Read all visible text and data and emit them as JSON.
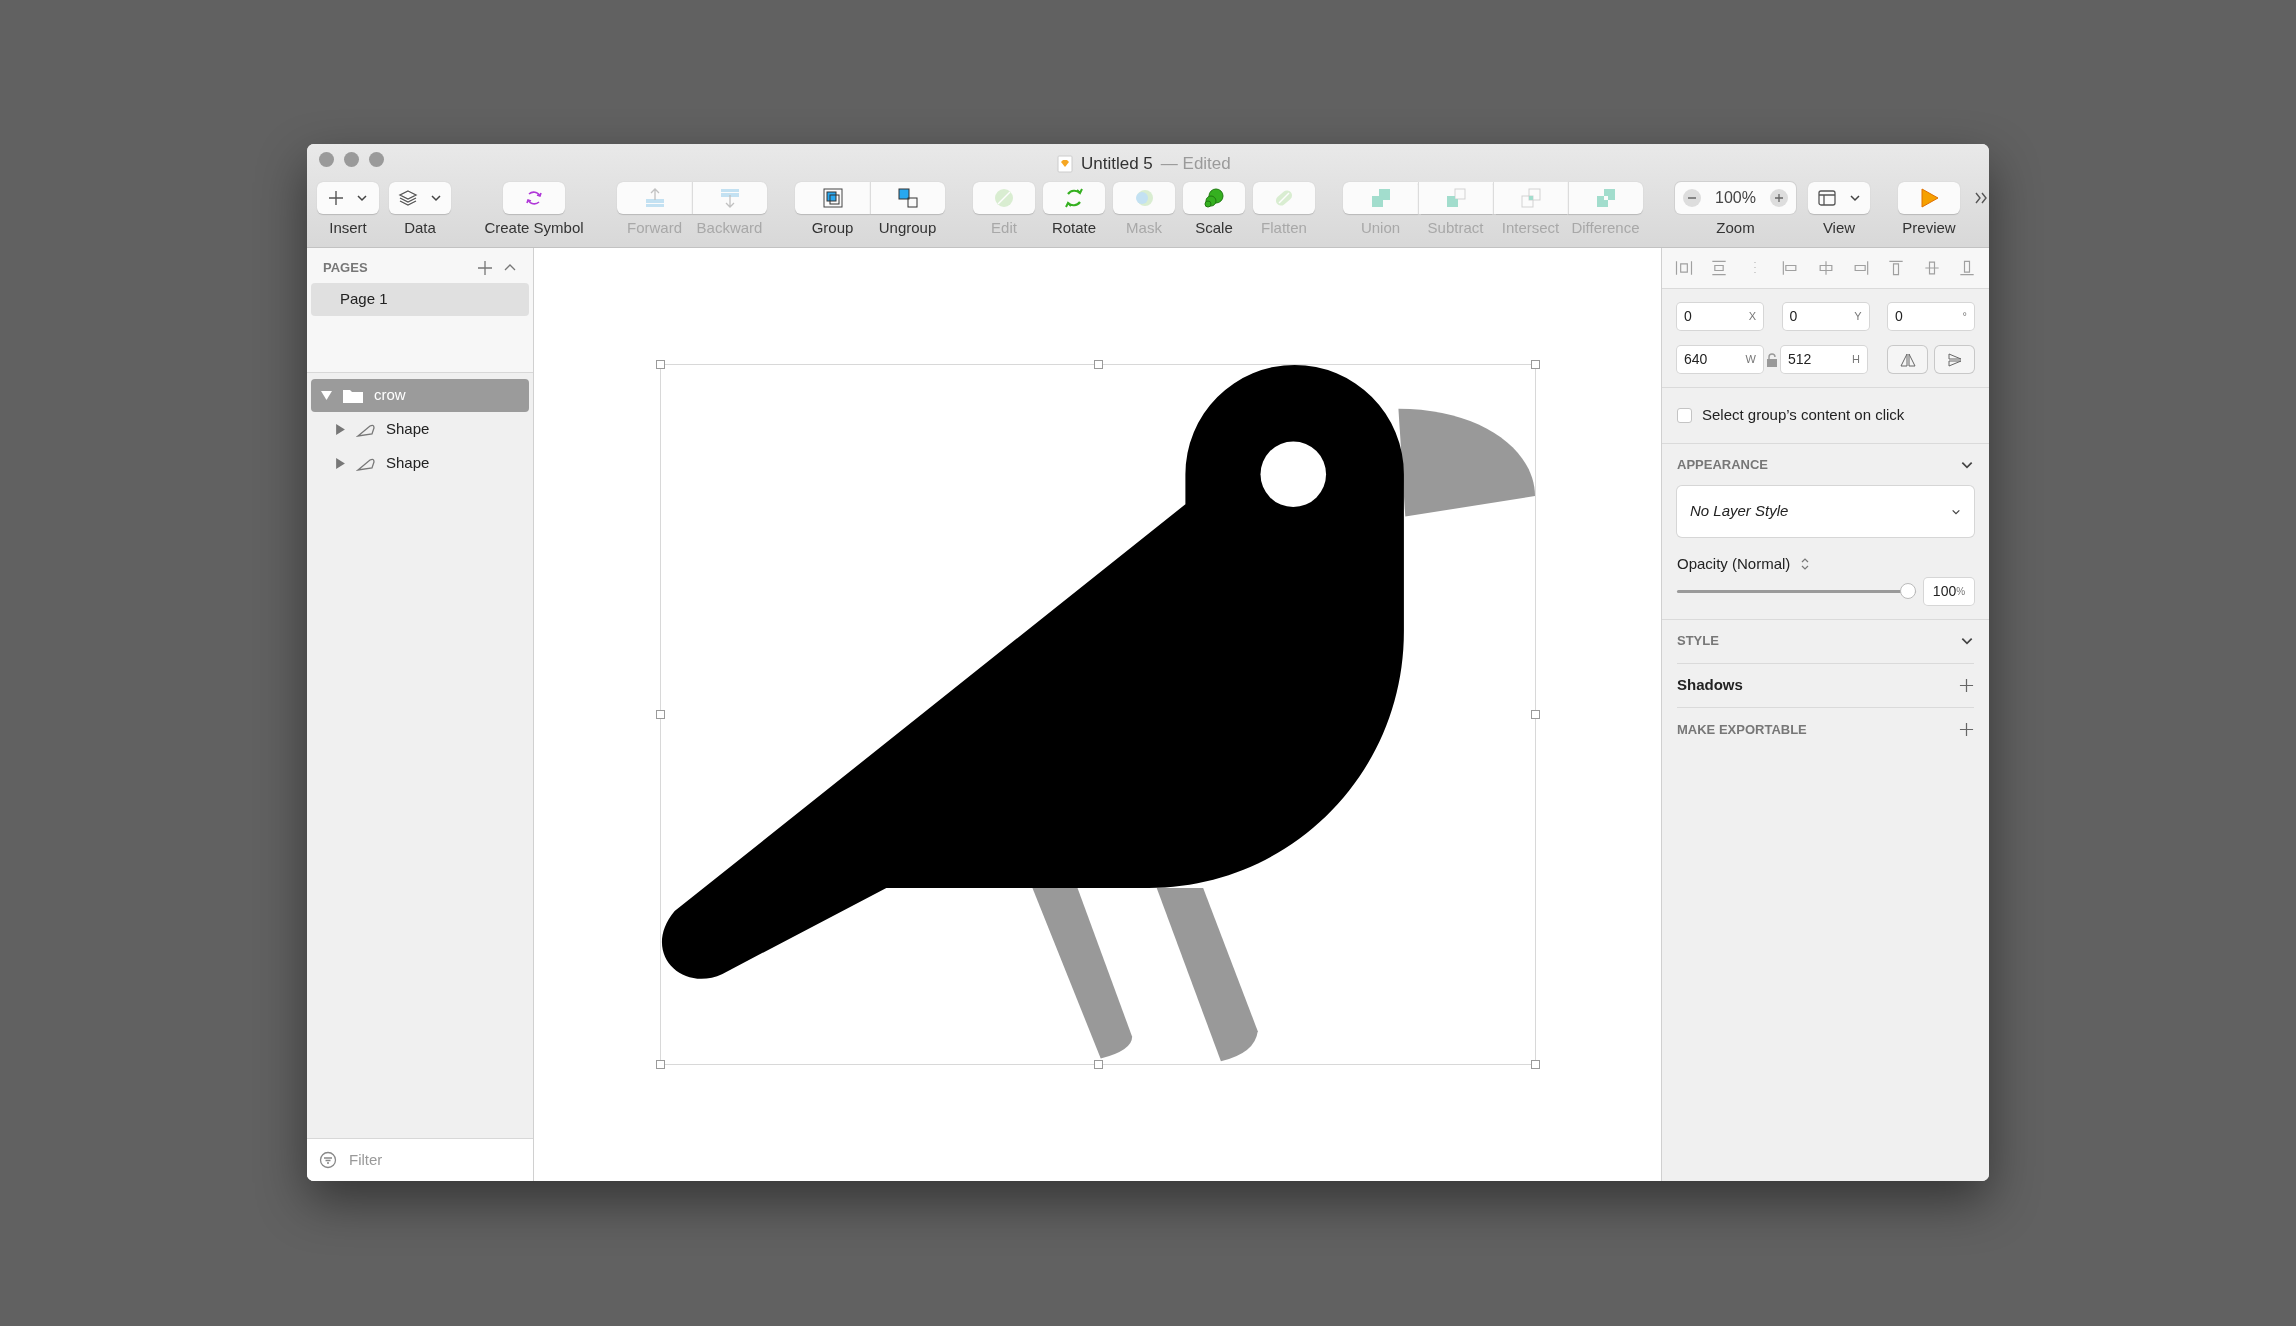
{
  "window": {
    "title": "Untitled 5",
    "status": "— Edited"
  },
  "toolbar": [
    {
      "items": [
        {
          "kind": "insert",
          "label": "Insert",
          "disabled": false
        },
        {
          "kind": "data",
          "label": "Data",
          "disabled": false
        }
      ]
    },
    {
      "items": [
        {
          "kind": "symbol",
          "label": "Create Symbol",
          "disabled": false
        }
      ]
    },
    {
      "segmented": true,
      "items": [
        {
          "kind": "forward",
          "label": "Forward",
          "disabled": true
        },
        {
          "kind": "backward",
          "label": "Backward",
          "disabled": true
        }
      ]
    },
    {
      "segmented": true,
      "items": [
        {
          "kind": "group",
          "label": "Group",
          "disabled": false
        },
        {
          "kind": "ungroup",
          "label": "Ungroup",
          "disabled": false
        }
      ]
    },
    {
      "items": [
        {
          "kind": "edit",
          "label": "Edit",
          "disabled": true
        },
        {
          "kind": "rotate",
          "label": "Rotate",
          "disabled": false
        },
        {
          "kind": "mask",
          "label": "Mask",
          "disabled": true
        },
        {
          "kind": "scale",
          "label": "Scale",
          "disabled": false
        },
        {
          "kind": "flatten",
          "label": "Flatten",
          "disabled": true
        }
      ]
    },
    {
      "segmented": true,
      "items": [
        {
          "kind": "union",
          "label": "Union",
          "disabled": true
        },
        {
          "kind": "subtract",
          "label": "Subtract",
          "disabled": true
        },
        {
          "kind": "intersect",
          "label": "Intersect",
          "disabled": true
        },
        {
          "kind": "difference",
          "label": "Difference",
          "disabled": true
        }
      ]
    },
    {
      "items": [
        {
          "kind": "zoom",
          "label": "Zoom",
          "value": "100%",
          "disabled": false
        }
      ]
    },
    {
      "items": [
        {
          "kind": "view",
          "label": "View",
          "disabled": false
        }
      ]
    },
    {
      "items": [
        {
          "kind": "preview",
          "label": "Preview",
          "disabled": false
        }
      ]
    }
  ],
  "sidebar": {
    "pages_title": "PAGES",
    "pages": [
      {
        "label": "Page 1",
        "selected": true
      }
    ],
    "layers": [
      {
        "name": "crow",
        "kind": "group",
        "selected": true,
        "expanded": true,
        "children": [
          {
            "name": "Shape",
            "kind": "shape",
            "selected": false,
            "expanded": false
          },
          {
            "name": "Shape",
            "kind": "shape",
            "selected": false,
            "expanded": false
          }
        ]
      }
    ],
    "filter": {
      "placeholder": "Filter"
    }
  },
  "inspector": {
    "position": [
      {
        "value": "0",
        "unit": "X"
      },
      {
        "value": "0",
        "unit": "Y"
      },
      {
        "value": "0",
        "unit": "°"
      }
    ],
    "size": [
      {
        "value": "640",
        "unit": "W"
      },
      {
        "value": "512",
        "unit": "H"
      }
    ],
    "ratio_locked": false,
    "group_select": {
      "label": "Select group’s content on click",
      "checked": false
    },
    "appearance": {
      "title": "APPEARANCE",
      "layer_style": "No Layer Style",
      "opacity_label": "Opacity (Normal)",
      "level": 1,
      "value": "100",
      "unit": "%"
    },
    "sections": [
      {
        "title": "STYLE",
        "kind": "collapse"
      },
      {
        "title": "Shadows",
        "kind": "add-bold"
      },
      {
        "title": "MAKE EXPORTABLE",
        "kind": "add"
      }
    ]
  }
}
